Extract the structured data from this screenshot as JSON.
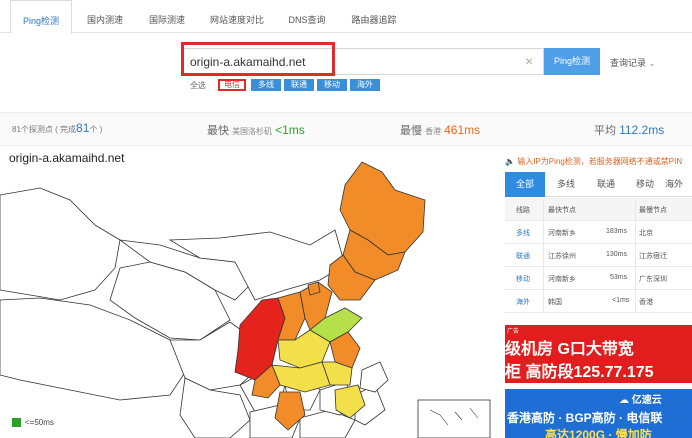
{
  "tabs": [
    {
      "label": "Ping检测",
      "active": true
    },
    {
      "label": "国内测速",
      "active": false
    },
    {
      "label": "国际测速",
      "active": false
    },
    {
      "label": "网站速度对比",
      "active": false
    },
    {
      "label": "DNS查询",
      "active": false
    },
    {
      "label": "路由器追踪",
      "active": false
    }
  ],
  "search": {
    "value": "origin-a.akamaihd.net",
    "clear_icon": "×",
    "button_label": "Ping检测",
    "history_label": "查询记录",
    "history_chevron": "⌄"
  },
  "filters": {
    "all_label": "全选",
    "items": [
      {
        "label": "电信",
        "selected": true
      },
      {
        "label": "多线",
        "selected": false
      },
      {
        "label": "联通",
        "selected": false
      },
      {
        "label": "移动",
        "selected": false
      },
      {
        "label": "海外",
        "selected": false
      }
    ]
  },
  "stats": {
    "total_prefix": "81个探测点 ( 完成",
    "total_done": "81",
    "total_suffix": "个 )",
    "fastest_label": "最快",
    "fastest_location": "美国洛杉矶",
    "fastest_value": "<1ms",
    "slowest_label": "最慢",
    "slowest_location": "香港",
    "slowest_value": "461ms",
    "average_label": "平均",
    "average_value": "112.2ms"
  },
  "map": {
    "title": "origin-a.akamaihd.net",
    "legend_label": "<=50ms",
    "colors": {
      "red": "#e3231c",
      "orange": "#f28c28",
      "yellow": "#f3df4a",
      "lightgreen": "#b6e04a",
      "outline": "#333333"
    }
  },
  "notice": "输入IP为Ping检测，若服务器网络不通或禁PIN",
  "right_tabs": [
    {
      "label": "全部",
      "active": true
    },
    {
      "label": "多线",
      "active": false
    },
    {
      "label": "联通",
      "active": false
    },
    {
      "label": "移动",
      "active": false
    },
    {
      "label": "海外",
      "active": false
    }
  ],
  "table": {
    "headers": [
      "线路",
      "最快节点",
      "最慢节点"
    ],
    "rows": [
      {
        "line": "多线",
        "fast_node": "河南新乡",
        "fast_time": "183ms",
        "slow_node": "北京"
      },
      {
        "line": "联通",
        "fast_node": "江苏徐州",
        "fast_time": "130ms",
        "slow_node": "江苏宿迁"
      },
      {
        "line": "移动",
        "fast_node": "河南新乡",
        "fast_time": "53ms",
        "slow_node": "广东深圳"
      },
      {
        "line": "海外",
        "fast_node": "韩国",
        "fast_time": "<1ms",
        "slow_node": "香港"
      }
    ]
  },
  "ads": {
    "ad1_tag": "广告",
    "ad1_line1": "级机房  G口大带宽",
    "ad1_line2": "柜  高防段125.77.175",
    "ad2_logo": "亿速云",
    "ad2_line1": "香港高防 · BGP高防 · 电信联",
    "ad2_line2": "高达1200G · 慢加防"
  }
}
